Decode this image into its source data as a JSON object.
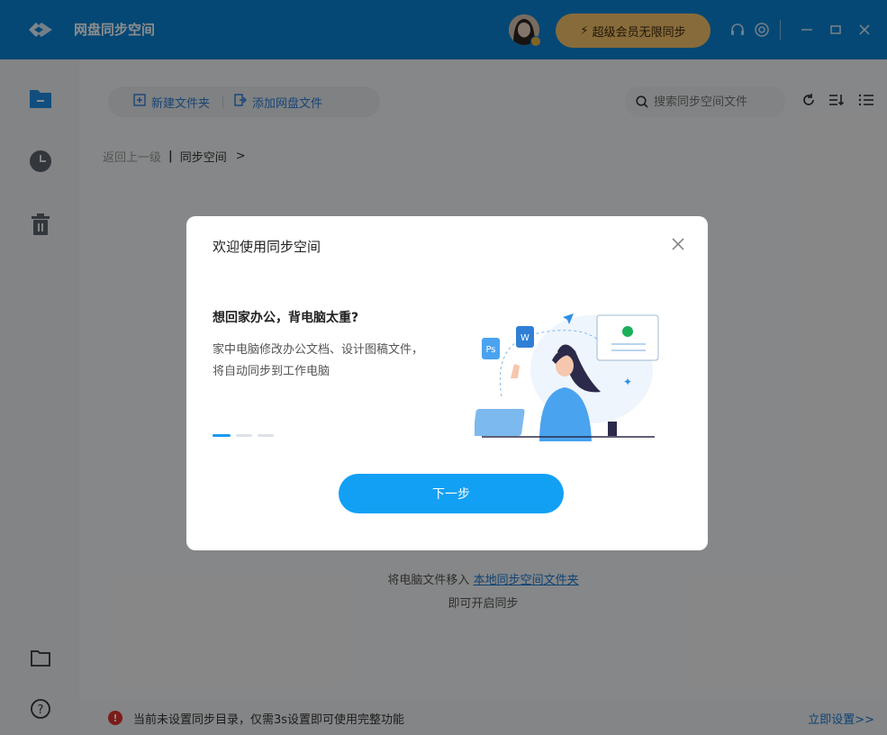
{
  "titlebar": {
    "app_title": "网盘同步空间",
    "vip_label": "超级会员无限同步",
    "vip_icon": "⚡"
  },
  "toolbar": {
    "new_folder": "新建文件夹",
    "add_cloud_file": "添加网盘文件",
    "search_placeholder": "搜索同步空间文件"
  },
  "breadcrumb": {
    "back": "返回上一级",
    "current": "同步空间",
    "arrow": ">"
  },
  "empty": {
    "line1_prefix": "将电脑文件移入",
    "line1_link": "本地同步空间文件夹",
    "line2": "即可开启同步"
  },
  "bottom": {
    "warning_text": "当前未设置同步目录，仅需3s设置即可使用完整功能",
    "setup_link": "立即设置>>"
  },
  "modal": {
    "title": "欢迎使用同步空间",
    "heading": "想回家办公，背电脑太重?",
    "description": "家中电脑修改办公文档、设计图稿文件，将自动同步到工作电脑",
    "next_button": "下一步",
    "step_index": 1,
    "step_count": 3
  },
  "colors": {
    "primary": "#0a84d6",
    "button": "#12a0f5",
    "vip": "#f7c46a",
    "warning": "#e0342f",
    "link": "#1a7ad4"
  }
}
